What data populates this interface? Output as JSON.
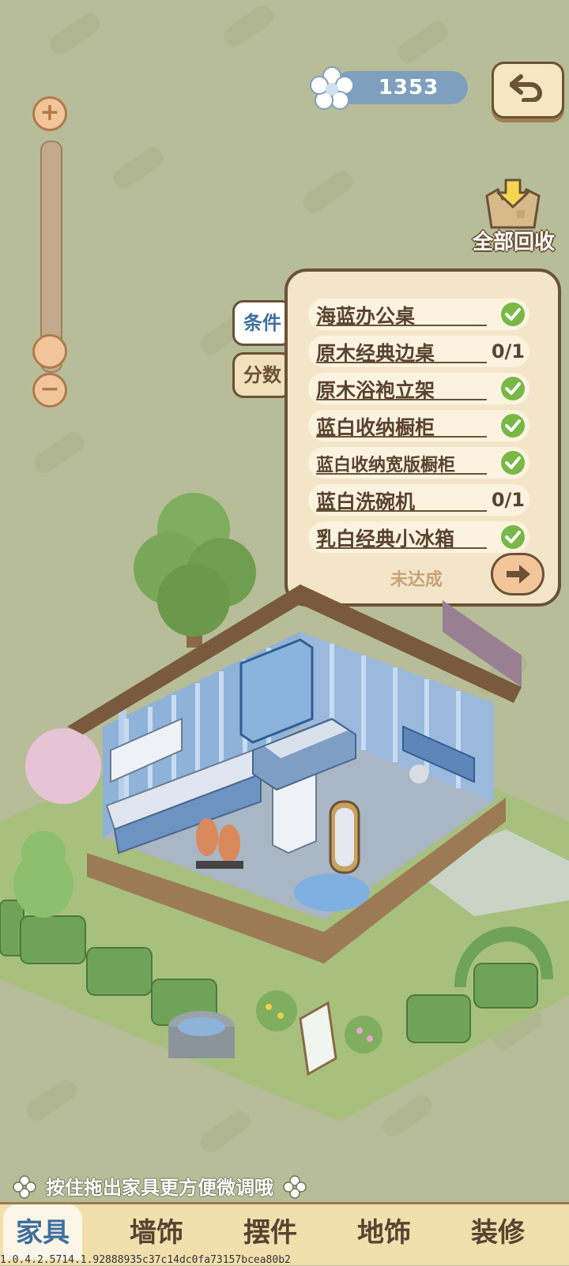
{
  "hud": {
    "currency_value": "1353",
    "recycle_label": "全部回收"
  },
  "panel": {
    "tabs": [
      {
        "label": "条件",
        "active": true
      },
      {
        "label": "分数",
        "active": false
      }
    ],
    "conditions": [
      {
        "name": "海蓝办公桌",
        "state": "check"
      },
      {
        "name": "原木经典边桌",
        "state": "count",
        "progress": "0/1"
      },
      {
        "name": "原木浴袍立架",
        "state": "check"
      },
      {
        "name": "蓝白收纳橱柜",
        "state": "check"
      },
      {
        "name": "蓝白收纳宽版橱柜",
        "state": "check"
      },
      {
        "name": "蓝白洗碗机",
        "state": "count",
        "progress": "0/1"
      },
      {
        "name": "乳白经典小冰箱",
        "state": "check"
      }
    ],
    "status_text": "未达成"
  },
  "hint": {
    "text": "按住拖出家具更方便微调哦"
  },
  "nav": {
    "items": [
      {
        "label": "家具",
        "active": true
      },
      {
        "label": "墙饰",
        "active": false
      },
      {
        "label": "摆件",
        "active": false
      },
      {
        "label": "地饰",
        "active": false
      },
      {
        "label": "装修",
        "active": false
      }
    ]
  },
  "footer": {
    "version": "1.0.4.2.5714.1.92888935c37c14dc0fa73157bcea80b2"
  },
  "colors": {
    "accent_blue": "#3f6f9c",
    "check_green": "#78b846",
    "border_brown": "#6a5236"
  }
}
